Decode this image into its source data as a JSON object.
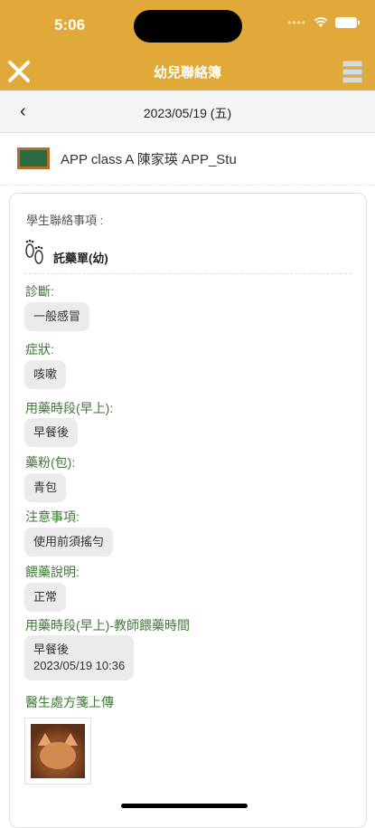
{
  "status_bar": {
    "time": "5:06",
    "dots": "••••"
  },
  "nav": {
    "title": "幼兒聯絡簿"
  },
  "date_bar": {
    "back_glyph": "‹",
    "date": "2023/05/19 (五)"
  },
  "class_info": {
    "text": "APP class A 陳家瑛 APP_Stu"
  },
  "card": {
    "title": "學生聯絡事項 :",
    "medication_title": "託藥單(幼)",
    "fields": [
      {
        "label": "診斷:",
        "value": "一般感冒"
      },
      {
        "label": "症狀:",
        "value": "咳嗽"
      },
      {
        "label": "用藥時段(早上):",
        "value": "早餐後"
      },
      {
        "label": "藥粉(包):",
        "value": "青包"
      },
      {
        "label": "注意事項:",
        "value": "使用前須搖勻"
      },
      {
        "label": "餵藥說明:",
        "value": "正常"
      }
    ],
    "teacher_time": {
      "label": "用藥時段(早上)-教師餵藥時間",
      "value_line1": "早餐後",
      "value_line2": "2023/05/19 10:36"
    },
    "upload_label": "醫生處方箋上傳"
  },
  "icons": {
    "close": "close-icon",
    "menu": "list-menu-icon",
    "back": "chevron-left-icon",
    "class": "blackboard-icon",
    "medication": "footprints-icon"
  },
  "colors": {
    "header": "#E1A93A",
    "label_green": "#3d7a33",
    "pill_bg": "#EBEBEB"
  }
}
